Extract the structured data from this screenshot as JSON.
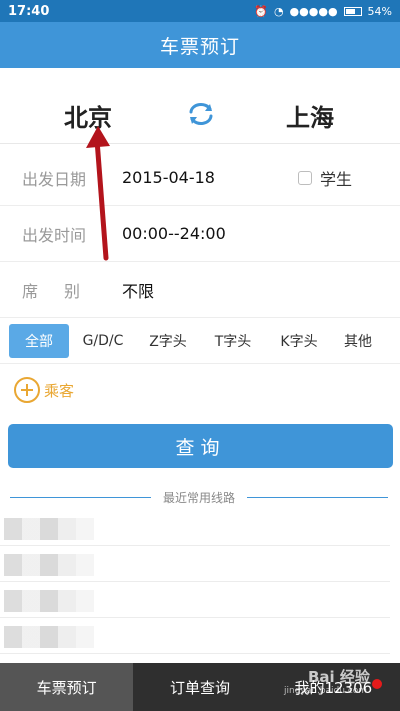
{
  "status_bar": {
    "time": "17:40",
    "battery": "54%",
    "signal": "●●●●●"
  },
  "header": {
    "title": "车票预订"
  },
  "route": {
    "from": "北京",
    "to": "上海",
    "swap_icon": "swap-arrows-icon",
    "accent": "#3f95d8"
  },
  "form": {
    "date_label": "出发日期",
    "date_value": "2015-04-18",
    "student_label": "学生",
    "time_label": "出发时间",
    "time_value": "00:00--24:00",
    "seat_label_1": "席",
    "seat_label_2": "别",
    "seat_value": "不限"
  },
  "filters": [
    "全部",
    "G/D/C",
    "Z字头",
    "T字头",
    "K字头",
    "其他"
  ],
  "passenger": {
    "label": "乘客",
    "icon": "plus-circle-icon"
  },
  "query": {
    "label": "查询"
  },
  "recent": {
    "title": "最近常用线路"
  },
  "bottom_nav": {
    "item1": "车票预订",
    "item2": "订单查询",
    "item3": "我的12306"
  },
  "watermark": {
    "brand": "Bai 经验",
    "url": "jingyan.baidu.com"
  }
}
